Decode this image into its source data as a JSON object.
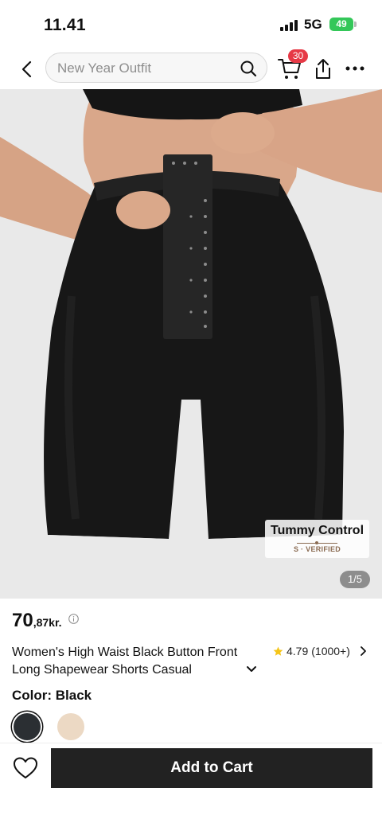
{
  "status": {
    "time": "11.41",
    "network": "5G",
    "battery": "49"
  },
  "nav": {
    "search_placeholder": "New Year Outfit",
    "cart_count": "30"
  },
  "image": {
    "tag_title": "Tummy Control",
    "tag_subtitle": "S · VERIFIED",
    "counter": "1/5"
  },
  "product": {
    "price_main": "70",
    "price_decimal": ",87kr.",
    "title": "Women's High Waist Black Button Front Long Shapewear Shorts Casual",
    "rating": "4.79",
    "reviews": "(1000+)",
    "color_label": "Color: Black",
    "colors": [
      {
        "name": "Black",
        "hex": "#2b2f33",
        "selected": true
      },
      {
        "name": "Nude",
        "hex": "#ecd9c4",
        "selected": false
      }
    ]
  },
  "footer": {
    "add_to_cart": "Add to Cart"
  },
  "theme": {
    "accent": "#222222",
    "badge": "#e63946",
    "star": "#f5c518"
  }
}
